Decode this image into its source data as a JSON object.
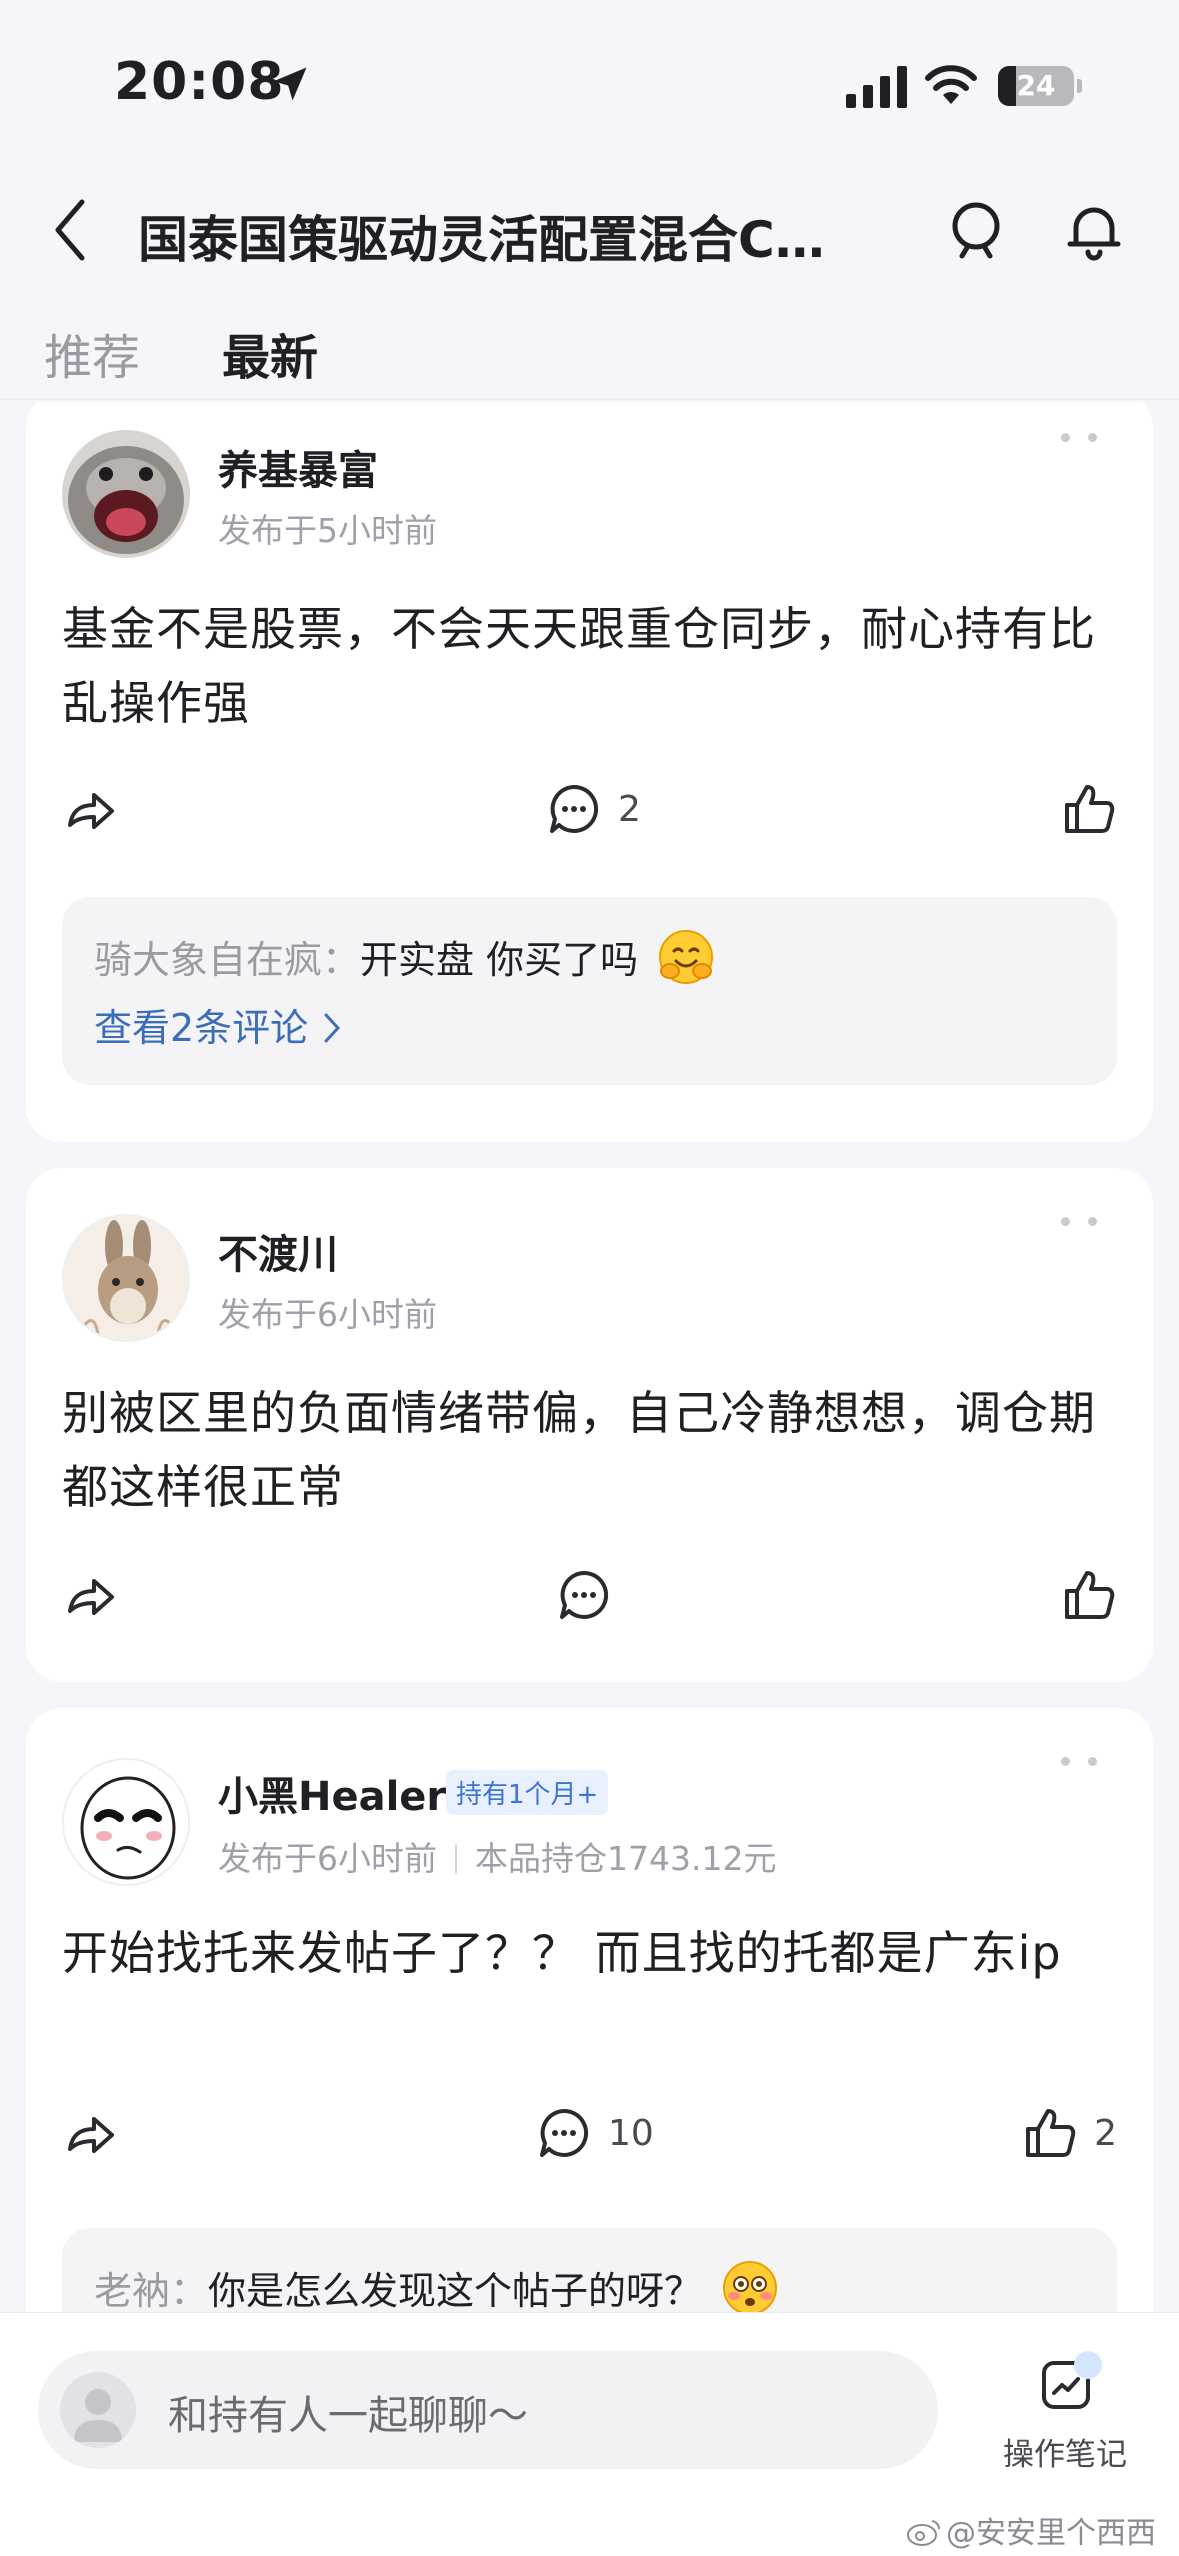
{
  "status_bar": {
    "time": "20:08",
    "battery_level": "24",
    "battery_fraction": 0.24
  },
  "nav": {
    "title": "国泰国策驱动灵活配置混合C…"
  },
  "tabs": [
    {
      "label": "推荐",
      "active": false
    },
    {
      "label": "最新",
      "active": true
    }
  ],
  "posts": [
    {
      "username": "养基暴富",
      "time": "发布于5小时前",
      "content": "基金不是股票，不会天天跟重仓同步，耐心持有比乱操作强",
      "comments": "2",
      "likes": "",
      "preview_comment": {
        "author": "骑大象自在疯：",
        "text": "开实盘 你买了吗",
        "emoji": "hugging-face-emoji"
      },
      "view_comments": "查看2条评论"
    },
    {
      "username": "不渡川",
      "time": "发布于6小时前",
      "content": "别被区里的负面情绪带偏，自己冷静想想，调仓期都这样很正常",
      "comments": "",
      "likes": ""
    },
    {
      "username": "小黑Healer",
      "badge": "持有1个月+",
      "time": "发布于6小时前",
      "holding": "本品持仓1743.12元",
      "content": "开始找托来发帖子了？？ 而且找的托都是广东ip",
      "comments": "10",
      "likes": "2",
      "preview_comment": {
        "author": "老衲：",
        "text": "你是怎么发现这个帖子的呀？",
        "emoji": "flushed-face-emoji"
      }
    }
  ],
  "bottom": {
    "chat_placeholder": "和持有人一起聊聊～",
    "notes_label": "操作笔记"
  },
  "watermark": "@安安里个西西",
  "colors": {
    "background": "#f5f6fa",
    "link_blue": "#3b6db8",
    "badge_blue": "#3b73d6"
  }
}
